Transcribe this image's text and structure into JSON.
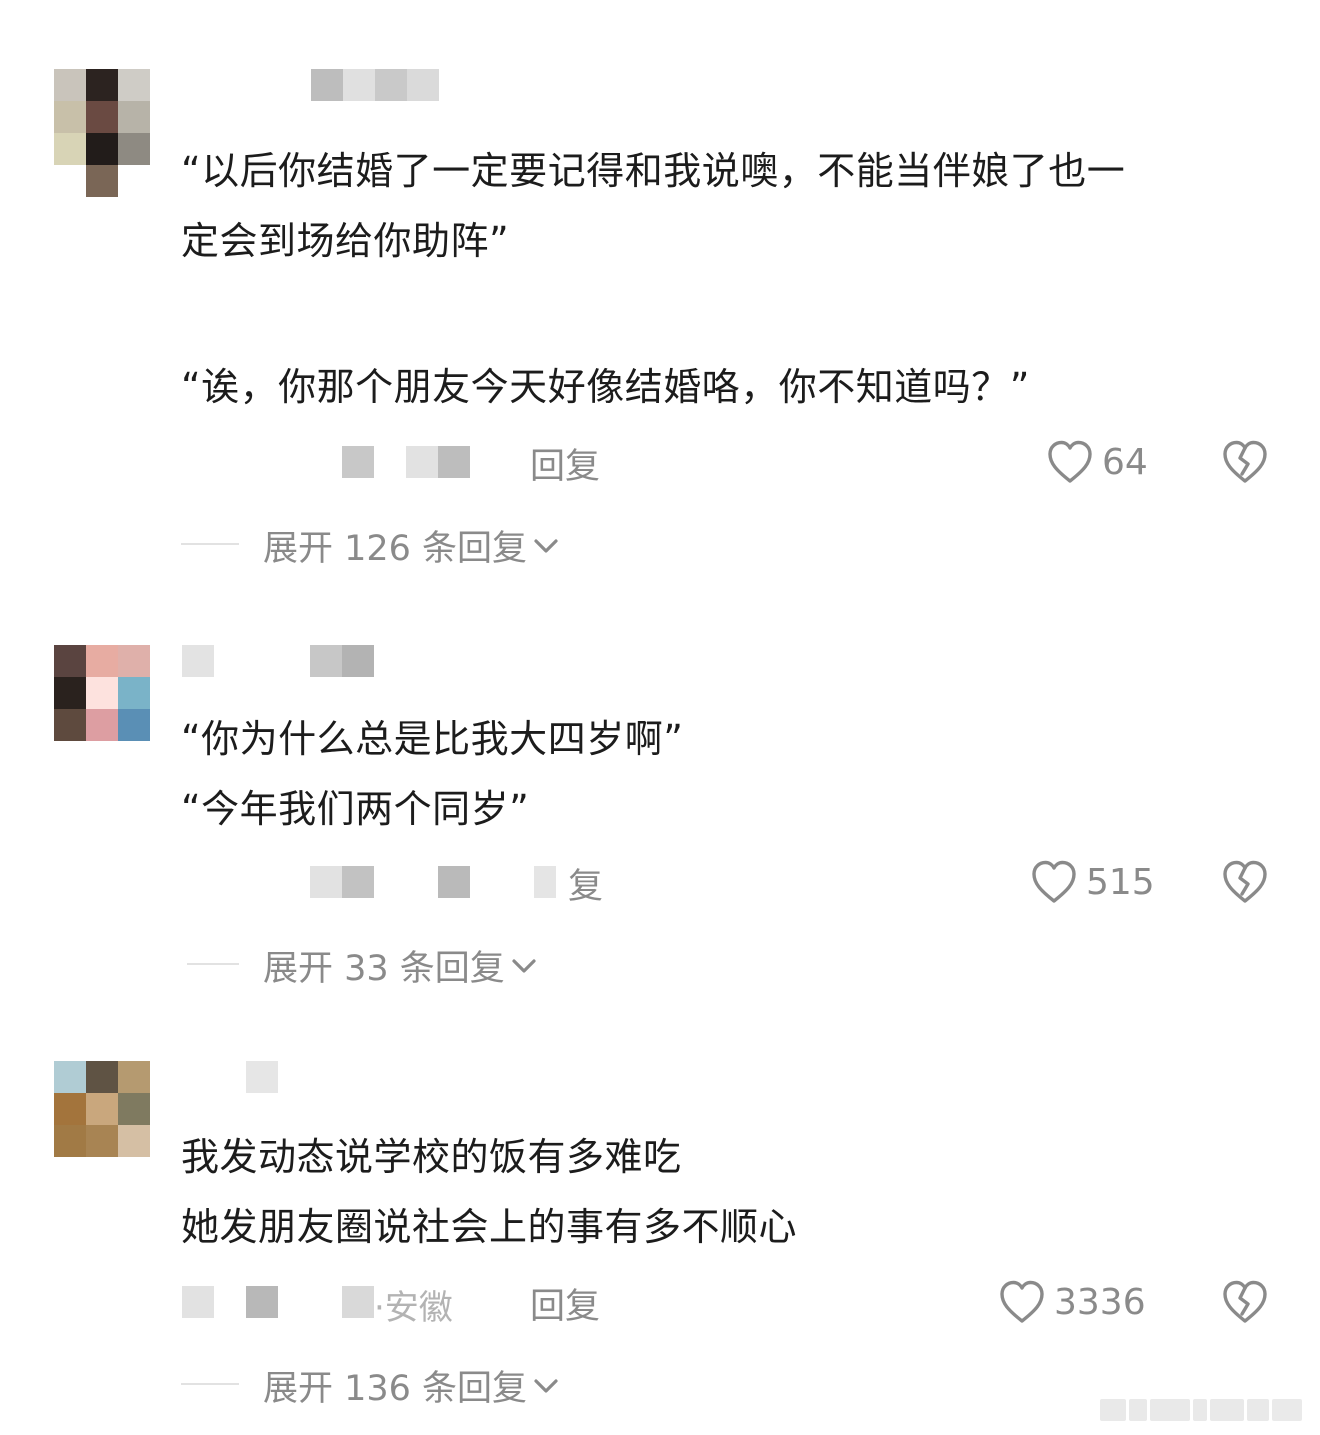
{
  "comments": [
    {
      "text_lines": [
        "“以后你结婚了一定要记得和我说噢，不能当伴娘了也一",
        "定会到场给你助阵”",
        "",
        "“诶，你那个朋友今天好像结婚咯，你不知道吗？”"
      ],
      "reply_label": "回复",
      "like_count": "64",
      "expand_label": "展开 126 条回复",
      "avatar_colors": [
        "#c9c4bb",
        "#2c2320",
        "#cfccc6",
        "#c8c0a9",
        "#6a4a42",
        "#b7b3a8",
        "#d8d4b6",
        "#221c1a",
        "#8e8a82",
        "#ffffff",
        "#7a6656",
        "#ffffff"
      ],
      "name_colors": [
        "#bdbdbd",
        "#e0e0e0",
        "#c9c9c9",
        "#dadada"
      ]
    },
    {
      "text_lines": [
        "“你为什么总是比我大四岁啊”",
        "“今年我们两个同岁”"
      ],
      "reply_label": "复",
      "like_count": "515",
      "expand_label": "展开 33 条回复",
      "avatar_colors": [
        "#5a4440",
        "#e7aca2",
        "#dfb0aa",
        "#2a221e",
        "#fde2de",
        "#7ab3c8",
        "#5e4a3e",
        "#dd9ea2",
        "#5a8fb5"
      ],
      "name_colors": [
        "#e3e3e3",
        "#c7c7c7",
        "#b3b3b3"
      ]
    },
    {
      "text_lines": [
        "我发动态说学校的饭有多难吃",
        "她发朋友圈说社会上的事有多不顺心"
      ],
      "date_location": "·安徽",
      "reply_label": "回复",
      "like_count": "3336",
      "expand_label": "展开 136 条回复",
      "avatar_colors": [
        "#b0ccd4",
        "#5f5344",
        "#b59a70",
        "#a3743c",
        "#c9a77d",
        "#7f7a60",
        "#a17a45",
        "#a88453",
        "#d5bfa4"
      ],
      "name_colors": [
        "#e6e6e6"
      ]
    }
  ],
  "icons": {
    "like": "heart-outline-icon",
    "dislike": "broken-heart-icon",
    "expand": "chevron-down-icon"
  },
  "colors": {
    "text": "#1c1c1c",
    "meta": "#8a8a8a",
    "rule": "#e2e2e2"
  }
}
